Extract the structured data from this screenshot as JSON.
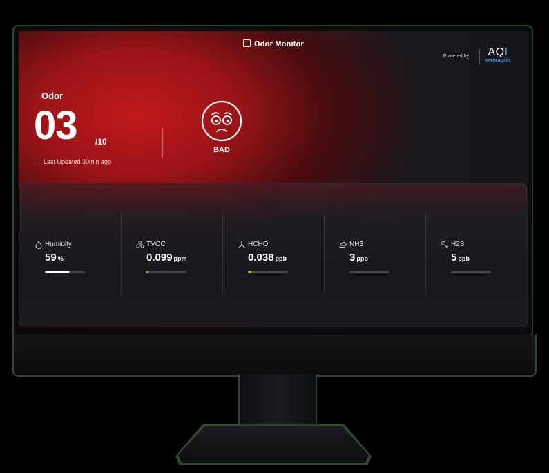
{
  "app": {
    "title": "Odor Monitor",
    "title_icon": "monitor-app-icon",
    "powered_by": "Powered by",
    "brand_prefix": "AQ",
    "brand_suffix": "I",
    "brand_url": "www.aqi.in"
  },
  "odor": {
    "label": "Odor",
    "value": "03",
    "scale": "/10",
    "last_updated": "Last Updated 30min ago",
    "status": "BAD",
    "status_icon": "sad-face-icon"
  },
  "colors": {
    "accent_red": "#c0181c",
    "brand_blue": "#3aa0ff",
    "bar_track": "#4a4a52",
    "bar_white": "#ffffff",
    "bar_yellow": "#e2d21c",
    "monitor_outline": "#2e4a2e"
  },
  "metrics": [
    {
      "label": "Humidity",
      "value": "59",
      "unit": "%",
      "icon": "droplet-icon",
      "level": 0.62,
      "bar_color": "#ffffff"
    },
    {
      "label": "TVOC",
      "value": "0.099",
      "unit": "ppm",
      "icon": "molecule-icon",
      "level": 0.04,
      "bar_color": "#e2d21c"
    },
    {
      "label": "HCHO",
      "value": "0.038",
      "unit": "ppb",
      "icon": "branch-molecule-icon",
      "level": 0.09,
      "bar_color": "#e2d21c"
    },
    {
      "label": "NH3",
      "value": "3",
      "unit": "ppb",
      "icon": "cloud-wind-icon",
      "level": 0,
      "bar_color": "#ffffff"
    },
    {
      "label": "H2S",
      "value": "5",
      "unit": "ppb",
      "icon": "gas-icon",
      "level": 0,
      "bar_color": "#ffffff"
    }
  ]
}
